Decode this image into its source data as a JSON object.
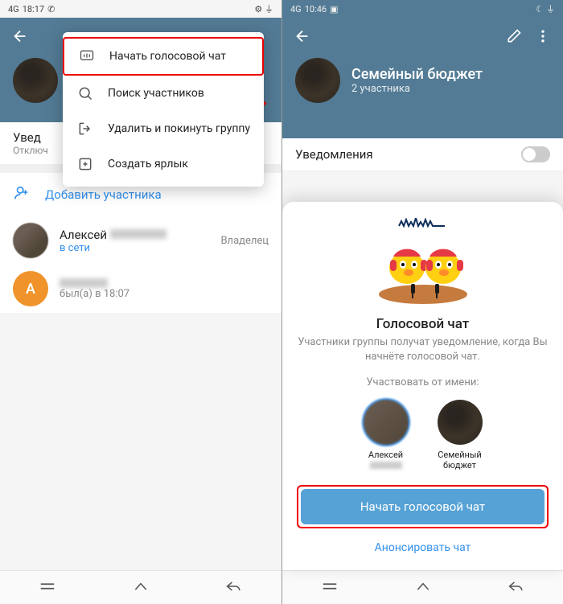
{
  "left": {
    "status": {
      "time": "18:17",
      "signal": "4G"
    },
    "group": {
      "name": "",
      "sub": ""
    },
    "notif": {
      "title": "Увед",
      "sub": "Отключ"
    },
    "add_member": "Добавить участника",
    "members": [
      {
        "name": "Алексей",
        "status": "в сети",
        "role": "Владелец"
      },
      {
        "name": "",
        "status": "был(а) в 18:07",
        "letter": "А"
      }
    ],
    "menu": [
      {
        "label": "Начать голосовой чат",
        "icon": "voice-chat-icon"
      },
      {
        "label": "Поиск участников",
        "icon": "search-icon"
      },
      {
        "label": "Удалить и покинуть группу",
        "icon": "leave-icon"
      },
      {
        "label": "Создать ярлык",
        "icon": "shortcut-icon"
      }
    ]
  },
  "right": {
    "status": {
      "time": "10:46",
      "signal": "4G"
    },
    "group": {
      "name": "Семейный бюджет",
      "sub": "2 участника"
    },
    "notif": {
      "title": "Уведомления"
    },
    "sheet": {
      "title": "Голосовой чат",
      "desc": "Участники группы получат уведомление, когда Вы начнёте голосовой чат.",
      "participate_as": "Участвовать от имени:",
      "identities": [
        {
          "name": "Алексей"
        },
        {
          "name": "Семейный бюджет"
        }
      ],
      "start_btn": "Начать голосовой чат",
      "announce": "Анонсировать чат"
    }
  }
}
